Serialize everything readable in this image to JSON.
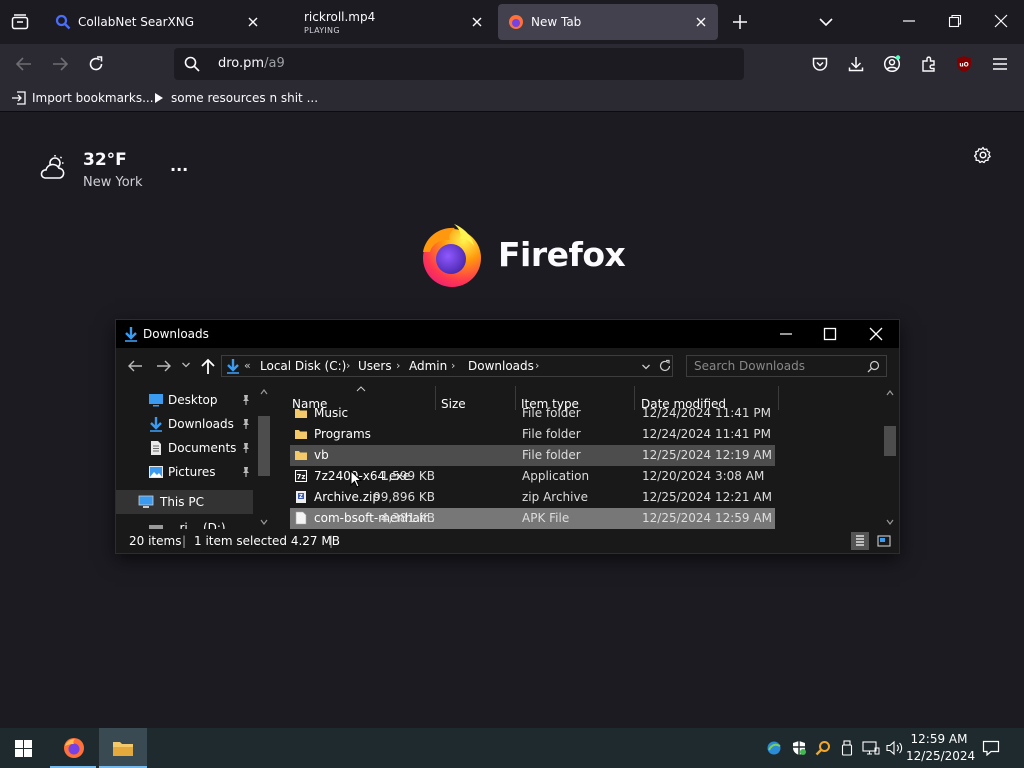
{
  "browser": {
    "tabs": [
      {
        "title": "CollabNet SearXNG",
        "subtitle": ""
      },
      {
        "title": "rickroll.mp4",
        "subtitle": "PLAYING"
      },
      {
        "title": "New Tab",
        "subtitle": "",
        "selected": true
      }
    ],
    "url": {
      "host": "dro.pm",
      "path": "/a9"
    },
    "bookmarks": [
      {
        "label": "Import bookmarks..."
      },
      {
        "label": "some resources n shit ..."
      }
    ],
    "accent": "#ff7139"
  },
  "newtab": {
    "weather": {
      "temperature": "32°F",
      "location": "New York",
      "more": "..."
    },
    "brand": "Firefox"
  },
  "explorer": {
    "title": "Downloads",
    "breadcrumb": [
      "Local Disk (C:)",
      "Users",
      "Admin",
      "Downloads"
    ],
    "overflow_chevrons": "«",
    "search_placeholder": "Search Downloads",
    "nav_items": [
      {
        "label": "Desktop",
        "pinned": true
      },
      {
        "label": "Downloads",
        "pinned": true
      },
      {
        "label": "Documents",
        "pinned": true
      },
      {
        "label": "Pictures",
        "pinned": true
      },
      {
        "label": "This PC",
        "pinned": false
      },
      {
        "label": "...ri...  (D:)",
        "pinned": false
      }
    ],
    "columns": [
      "Name",
      "Size",
      "Item type",
      "Date modified"
    ],
    "rows": [
      {
        "name": "Music",
        "size": "",
        "type": "File folder",
        "date": "12/24/2024 11:41 PM",
        "kind": "folder"
      },
      {
        "name": "Programs",
        "size": "",
        "type": "File folder",
        "date": "12/24/2024 11:41 PM",
        "kind": "folder"
      },
      {
        "name": "vb",
        "size": "",
        "type": "File folder",
        "date": "12/25/2024 12:19 AM",
        "kind": "folder"
      },
      {
        "name": "7z2409-x64.exe",
        "size": "1,599 KB",
        "type": "Application",
        "date": "12/20/2024 3:08 AM",
        "kind": "exe"
      },
      {
        "name": "Archive.zip",
        "size": "99,896 KB",
        "type": "zip Archive",
        "date": "12/25/2024 12:21 AM",
        "kind": "zip"
      },
      {
        "name": "com-bsoft-menhair...",
        "size": "4,381 KB",
        "type": "APK File",
        "date": "12/25/2024 12:59 AM",
        "kind": "file"
      }
    ],
    "status": {
      "items": "20 items",
      "selected": "1 item selected  4.27 MB"
    }
  },
  "taskbar": {
    "time": "12:59 AM",
    "date": "12/25/2024"
  }
}
